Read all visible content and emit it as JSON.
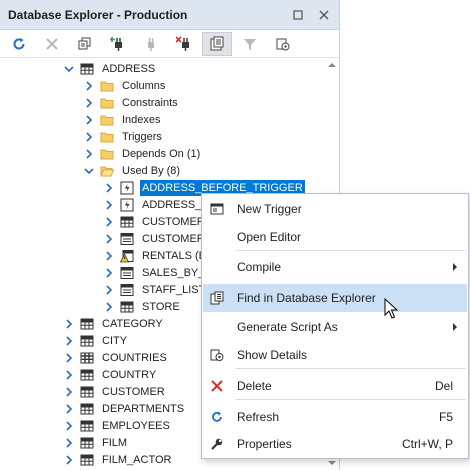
{
  "window": {
    "title": "Database Explorer - Production"
  },
  "toolbar": {
    "items": [
      {
        "name": "refresh-icon"
      },
      {
        "name": "disconnect-icon"
      },
      {
        "name": "duplicate-icon"
      },
      {
        "name": "new-connection-icon"
      },
      {
        "name": "connect-icon"
      },
      {
        "name": "remove-connection-icon"
      },
      {
        "name": "find-in-explorer-icon"
      },
      {
        "name": "filter-icon"
      },
      {
        "name": "database-settings-icon"
      }
    ]
  },
  "tree": {
    "rows": [
      {
        "label": "ADDRESS",
        "icon": "table",
        "chevron": "down"
      },
      {
        "label": "Columns",
        "icon": "folder",
        "chevron": "right"
      },
      {
        "label": "Constraints",
        "icon": "folder",
        "chevron": "right"
      },
      {
        "label": "Indexes",
        "icon": "folder",
        "chevron": "right"
      },
      {
        "label": "Triggers",
        "icon": "folder",
        "chevron": "right"
      },
      {
        "label": "Depends On (1)",
        "icon": "folder",
        "chevron": "right"
      },
      {
        "label": "Used By (8)",
        "icon": "folder-open",
        "chevron": "down"
      },
      {
        "label": "ADDRESS_BEFORE_TRIGGER",
        "icon": "trigger",
        "chevron": "right",
        "selected": true
      },
      {
        "label": "ADDRESS_BE",
        "icon": "trigger",
        "chevron": "right"
      },
      {
        "label": "CUSTOMER",
        "icon": "table",
        "chevron": "right"
      },
      {
        "label": "CUSTOMER_I",
        "icon": "view",
        "chevron": "right"
      },
      {
        "label": "RENTALS (Bo",
        "icon": "warning-view",
        "chevron": "right"
      },
      {
        "label": "SALES_BY_ST",
        "icon": "view",
        "chevron": "right"
      },
      {
        "label": "STAFF_LIST",
        "icon": "view",
        "chevron": "right"
      },
      {
        "label": "STORE",
        "icon": "table",
        "chevron": "right"
      },
      {
        "label": "CATEGORY",
        "icon": "table",
        "chevron": "right"
      },
      {
        "label": "CITY",
        "icon": "table",
        "chevron": "right"
      },
      {
        "label": "COUNTRIES",
        "icon": "grid-table",
        "chevron": "right"
      },
      {
        "label": "COUNTRY",
        "icon": "table",
        "chevron": "right"
      },
      {
        "label": "CUSTOMER",
        "icon": "table",
        "chevron": "right"
      },
      {
        "label": "DEPARTMENTS",
        "icon": "table",
        "chevron": "right"
      },
      {
        "label": "EMPLOYEES",
        "icon": "table",
        "chevron": "right"
      },
      {
        "label": "FILM",
        "icon": "table",
        "chevron": "right"
      },
      {
        "label": "FILM_ACTOR",
        "icon": "table",
        "chevron": "right"
      }
    ]
  },
  "context_menu": {
    "items": [
      {
        "label": "New Trigger",
        "icon": "new-trigger-icon",
        "shortcut": ""
      },
      {
        "label": "Open Editor",
        "icon": "",
        "shortcut": ""
      },
      {
        "label": "Compile",
        "icon": "",
        "shortcut": "",
        "submenu": true
      },
      {
        "label": "Find in Database Explorer",
        "icon": "find-in-explorer-icon",
        "shortcut": "",
        "highlighted": true
      },
      {
        "label": "Generate Script As",
        "icon": "",
        "shortcut": "",
        "submenu": true
      },
      {
        "label": "Show Details",
        "icon": "show-details-icon",
        "shortcut": ""
      },
      {
        "label": "Delete",
        "icon": "delete-icon",
        "shortcut": "Del"
      },
      {
        "label": "Refresh",
        "icon": "refresh-icon",
        "shortcut": "F5"
      },
      {
        "label": "Properties",
        "icon": "properties-icon",
        "shortcut": "Ctrl+W, P"
      }
    ]
  },
  "colors": {
    "selection": "#0078d7",
    "menu_highlight": "#cce0f5",
    "titlebar": "#dde5f1",
    "chevron": "#2b6cb0",
    "delete_red": "#d0312d",
    "refresh_blue": "#1f6fc5"
  }
}
